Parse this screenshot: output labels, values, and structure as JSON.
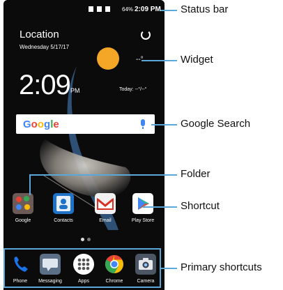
{
  "status_bar": {
    "battery_pct": "64%",
    "time": "2:09 PM"
  },
  "widget": {
    "location": "Location",
    "date": "Wednesday 5/17/17",
    "temperature": "--°",
    "clock": "2:09",
    "ampm": "PM",
    "today": "Today: --°/--°"
  },
  "search": {
    "logo": "Google"
  },
  "home_apps": [
    {
      "label": "Google",
      "icon": "folder-icon"
    },
    {
      "label": "Contacts",
      "icon": "contacts-icon"
    },
    {
      "label": "Email",
      "icon": "email-icon"
    },
    {
      "label": "Play Store",
      "icon": "play-store-icon"
    }
  ],
  "dock": [
    {
      "label": "Phone",
      "icon": "phone-icon"
    },
    {
      "label": "Messaging",
      "icon": "messaging-icon"
    },
    {
      "label": "Apps",
      "icon": "apps-icon"
    },
    {
      "label": "Chrome",
      "icon": "chrome-icon"
    },
    {
      "label": "Camera",
      "icon": "camera-icon"
    }
  ],
  "callouts": {
    "status_bar": "Status bar",
    "widget": "Widget",
    "google_search": "Google Search",
    "folder": "Folder",
    "shortcut": "Shortcut",
    "primary_shortcuts": "Primary shortcuts"
  },
  "colors": {
    "accent": "#5aa7d8",
    "sun": "#f4a726"
  }
}
